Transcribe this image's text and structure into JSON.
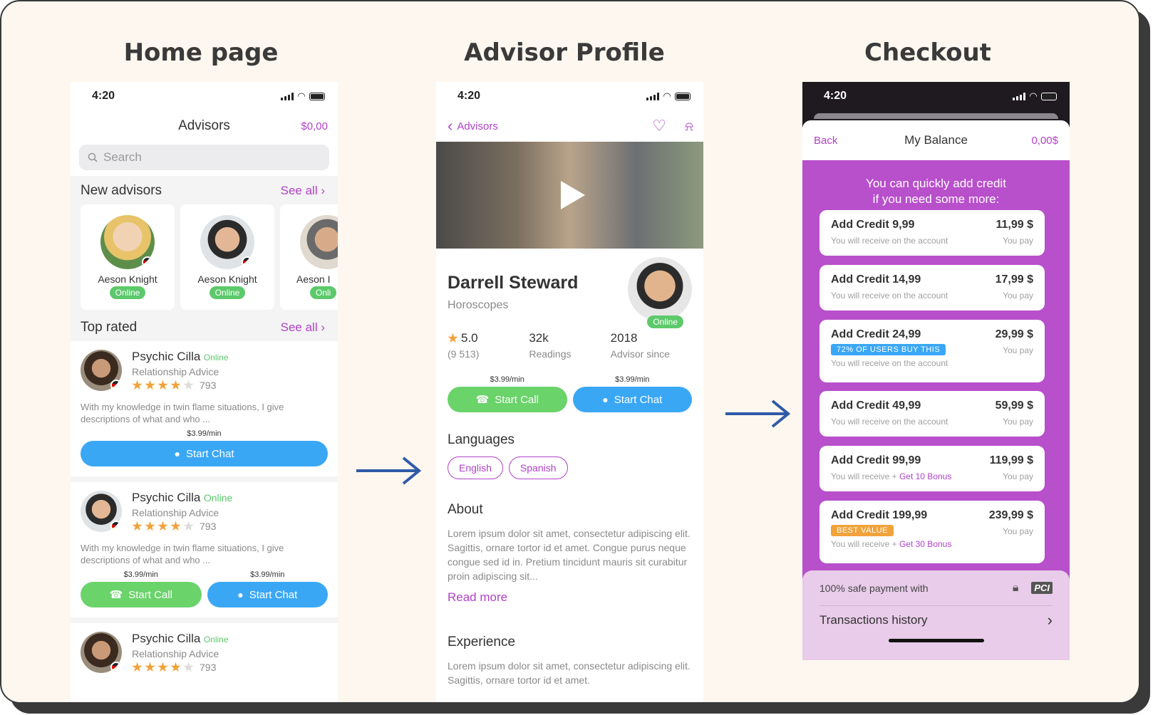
{
  "titles": {
    "home": "Home page",
    "profile": "Advisor Profile",
    "checkout": "Checkout"
  },
  "status_time": "4:20",
  "home": {
    "header_title": "Advisors",
    "balance": "$0,00",
    "search_placeholder": "Search",
    "new_advisors": {
      "title": "New advisors",
      "see_all": "See all",
      "items": [
        {
          "name": "Aeson Knight",
          "status": "Online"
        },
        {
          "name": "Aeson Knight",
          "status": "Online"
        },
        {
          "name": "Aeson I",
          "status": "Onli"
        }
      ]
    },
    "top_rated": {
      "title": "Top rated",
      "see_all": "See all",
      "items": [
        {
          "name": "Psychic Cilla",
          "status": "Online",
          "category": "Relationship Advice",
          "rating": 4,
          "reviews": "793",
          "desc": "With my knowledge in twin flame situations, I give descriptions of what and who ...",
          "chat_price": "$3.99/min",
          "chat_label": "Start Chat"
        },
        {
          "name": "Psychic Cilla",
          "status": "Online",
          "category": "Relationship Advice",
          "rating": 4,
          "reviews": "793",
          "desc": "With my knowledge in twin flame situations, I give descriptions of what and who ...",
          "call_price": "$3.99/min",
          "call_label": "Start Call",
          "chat_price": "$3.99/min",
          "chat_label": "Start Chat"
        },
        {
          "name": "Psychic Cilla",
          "status": "Online",
          "category": "Relationship Advice",
          "rating": 4,
          "reviews": "793"
        }
      ]
    }
  },
  "profile": {
    "back_label": "Advisors",
    "name": "Darrell Steward",
    "category": "Horoscopes",
    "status": "Online",
    "stats": [
      {
        "value": "5.0",
        "label": "(9 513)"
      },
      {
        "value": "32k",
        "label": "Readings"
      },
      {
        "value": "2018",
        "label": "Advisor since"
      }
    ],
    "call_price": "$3.99/min",
    "call_label": "Start Call",
    "chat_price": "$3.99/min",
    "chat_label": "Start Chat",
    "languages_title": "Languages",
    "languages": [
      "English",
      "Spanish"
    ],
    "about_title": "About",
    "about_text": "Lorem ipsum dolor sit amet, consectetur adipiscing elit. Sagittis, ornare tortor id et amet. Congue purus neque congue sed id in. Pretium tincidunt mauris sit curabitur proin adipiscing sit...",
    "read_more": "Read more",
    "experience_title": "Experience",
    "experience_text": "Lorem ipsum dolor sit amet, consectetur adipiscing elit. Sagittis, ornare tortor id et amet."
  },
  "checkout": {
    "back": "Back",
    "title": "My Balance",
    "balance": "0,00$",
    "banner_line1": "You can quickly add credit",
    "banner_line2": "if you need some more:",
    "you_pay": "You pay",
    "credits": [
      {
        "title": "Add Credit 9,99",
        "price": "11,99 $",
        "sub": "You will receive on the account"
      },
      {
        "title": "Add Credit 14,99",
        "price": "17,99 $",
        "sub": "You will receive on the account"
      },
      {
        "title": "Add Credit 24,99",
        "price": "29,99 $",
        "tag": "72% OF USERS BUY THIS",
        "sub": "You will receive on the account"
      },
      {
        "title": "Add Credit 49,99",
        "price": "59,99 $",
        "sub": "You will receive on the account"
      },
      {
        "title": "Add Credit 99,99",
        "price": "119,99 $",
        "sub": "You will receive + ",
        "bonus": "Get 10 Bonus"
      },
      {
        "title": "Add Credit 199,99",
        "price": "239,99 $",
        "tag": "BEST VALUE",
        "sub": "You will receive + ",
        "bonus": "Get 30 Bonus"
      }
    ],
    "safe_payment": "100% safe payment with",
    "transactions": "Transactions history"
  },
  "colors": {
    "accent": "#b141c9",
    "green": "#5cc96b",
    "blue": "#3aa7f5",
    "arrow": "#2f5aa8",
    "star": "#f2a23a"
  }
}
